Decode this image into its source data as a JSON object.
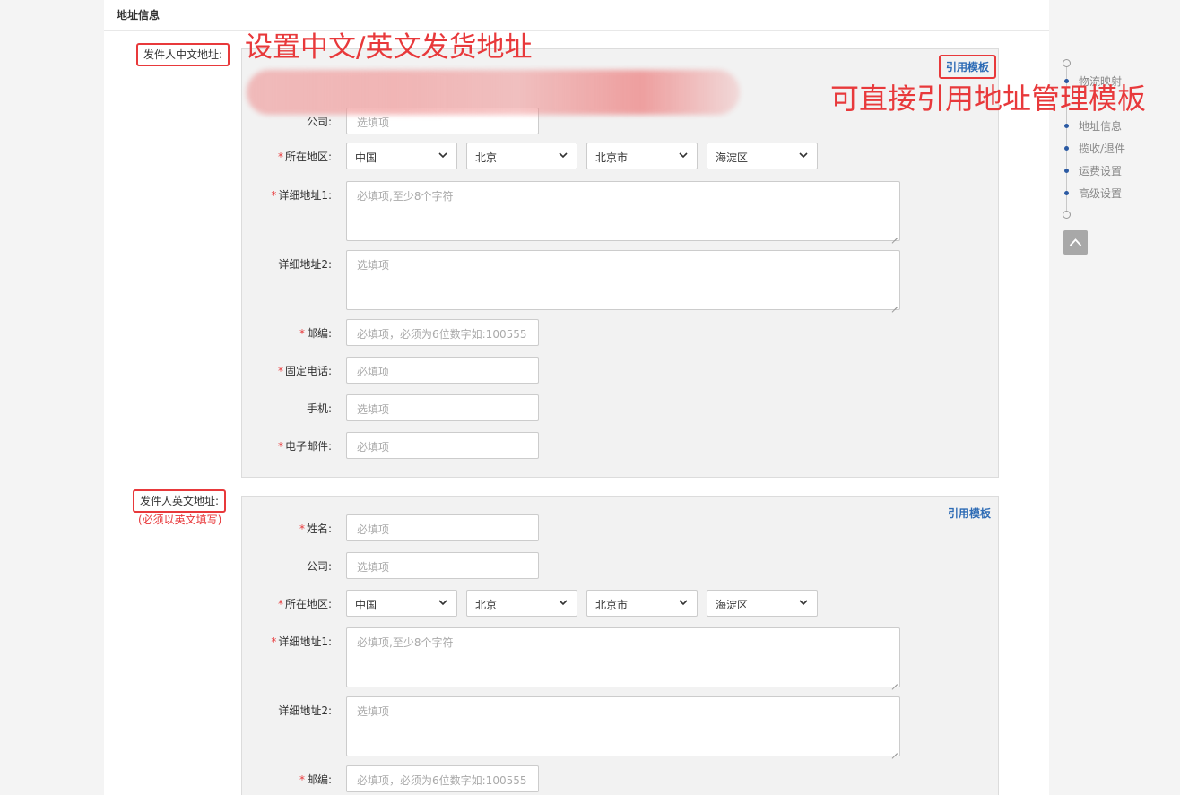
{
  "section_title": "地址信息",
  "annotations": {
    "top": "设置中文/英文发货地址",
    "right": "可直接引用地址管理模板"
  },
  "cn": {
    "sender_label": "发件人中文地址:",
    "template_link": "引用模板",
    "company": {
      "label": "公司:",
      "placeholder": "选填项"
    },
    "region": {
      "label": "所在地区:",
      "country": "中国",
      "province": "北京",
      "city": "北京市",
      "district": "海淀区"
    },
    "address1": {
      "label": "详细地址1:",
      "placeholder": "必填项,至少8个字符"
    },
    "address2": {
      "label": "详细地址2:",
      "placeholder": "选填项"
    },
    "zip": {
      "label": "邮编:",
      "placeholder": "必填项，必须为6位数字如:100555"
    },
    "phone": {
      "label": "固定电话:",
      "placeholder": "必填项"
    },
    "mobile": {
      "label": "手机:",
      "placeholder": "选填项"
    },
    "email": {
      "label": "电子邮件:",
      "placeholder": "必填项"
    }
  },
  "en": {
    "sender_label": "发件人英文地址:",
    "note": "(必须以英文填写)",
    "template_link": "引用模板",
    "name": {
      "label": "姓名:",
      "placeholder": "必填项"
    },
    "company": {
      "label": "公司:",
      "placeholder": "选填项"
    },
    "region": {
      "label": "所在地区:",
      "country": "中国",
      "province": "北京",
      "city": "北京市",
      "district": "海淀区"
    },
    "address1": {
      "label": "详细地址1:",
      "placeholder": "必填项,至少8个字符"
    },
    "address2": {
      "label": "详细地址2:",
      "placeholder": "选填项"
    },
    "zip": {
      "label": "邮编:",
      "placeholder": "必填项，必须为6位数字如:100555"
    }
  },
  "nav": {
    "items": [
      "物流映射",
      "地址信息",
      "揽收/退件",
      "运费设置",
      "高级设置"
    ]
  },
  "colors": {
    "accent_red": "#e8393b",
    "link_blue": "#2d6bb5",
    "nav_dot": "#2b5aa3"
  }
}
